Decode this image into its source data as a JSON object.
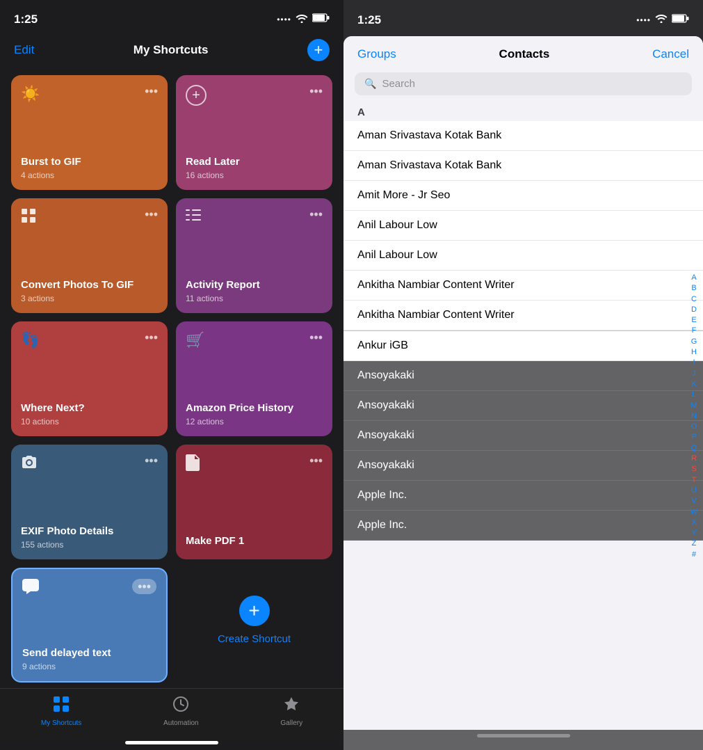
{
  "leftPanel": {
    "statusBar": {
      "time": "1:25"
    },
    "navBar": {
      "editLabel": "Edit",
      "title": "My Shortcuts",
      "addButtonLabel": "+"
    },
    "shortcuts": [
      {
        "id": "burst-to-gif",
        "title": "Burst to GIF",
        "actions": "4 actions",
        "icon": "☀",
        "colorClass": "card-burst"
      },
      {
        "id": "read-later",
        "title": "Read Later",
        "actions": "16 actions",
        "icon": "+",
        "colorClass": "card-read-later",
        "isAddIcon": true
      },
      {
        "id": "convert-photos",
        "title": "Convert Photos To GIF",
        "actions": "3 actions",
        "icon": "⊞",
        "colorClass": "card-convert"
      },
      {
        "id": "activity-report",
        "title": "Activity Report",
        "actions": "11 actions",
        "icon": "≡",
        "colorClass": "card-activity"
      },
      {
        "id": "where-next",
        "title": "Where Next?",
        "actions": "10 actions",
        "icon": "👣",
        "colorClass": "card-where-next"
      },
      {
        "id": "amazon-price",
        "title": "Amazon Price History",
        "actions": "12 actions",
        "icon": "🛒",
        "colorClass": "card-amazon"
      },
      {
        "id": "exif-photo",
        "title": "EXIF Photo Details",
        "actions": "155 actions",
        "icon": "⊙",
        "colorClass": "card-exif"
      },
      {
        "id": "make-pdf",
        "title": "Make PDF 1",
        "actions": "",
        "icon": "📄",
        "colorClass": "card-make-pdf"
      }
    ],
    "sendDelayed": {
      "title": "Send delayed text",
      "actions": "9 actions",
      "icon": "💬",
      "colorClass": "card-send-delayed"
    },
    "createShortcutLabel": "Create Shortcut",
    "tabBar": {
      "tabs": [
        {
          "id": "my-shortcuts",
          "label": "My Shortcuts",
          "icon": "⊞",
          "active": true
        },
        {
          "id": "automation",
          "label": "Automation",
          "icon": "🕐",
          "active": false
        },
        {
          "id": "gallery",
          "label": "Gallery",
          "icon": "🎓",
          "active": false
        }
      ]
    }
  },
  "rightPanel": {
    "statusBar": {
      "time": "1:25"
    },
    "contacts": {
      "groupsLabel": "Groups",
      "title": "Contacts",
      "cancelLabel": "Cancel",
      "searchPlaceholder": "Search",
      "sectionHeader": "A",
      "contacts": [
        {
          "name": "Aman Srivastava Kotak Bank",
          "highlighted": false
        },
        {
          "name": "Aman Srivastava Kotak Bank",
          "highlighted": false
        },
        {
          "name": "Amit More - Jr Seo",
          "highlighted": false
        },
        {
          "name": "Anil Labour Low",
          "highlighted": false
        },
        {
          "name": "Anil Labour Low",
          "highlighted": false
        },
        {
          "name": "Ankitha Nambiar Content Writer",
          "highlighted": false
        },
        {
          "name": "Ankitha Nambiar Content Writer",
          "highlighted": false
        },
        {
          "name": "Ankur iGB",
          "highlighted": true
        },
        {
          "name": "Ansoyakaki",
          "highlighted": false
        },
        {
          "name": "Ansoyakaki",
          "highlighted": false
        },
        {
          "name": "Ansoyakaki",
          "highlighted": false
        },
        {
          "name": "Ansoyakaki",
          "highlighted": false
        },
        {
          "name": "Apple Inc.",
          "highlighted": false
        },
        {
          "name": "Apple Inc.",
          "highlighted": false
        }
      ],
      "alphaIndex": [
        "A",
        "B",
        "C",
        "D",
        "E",
        "F",
        "G",
        "H",
        "I",
        "J",
        "K",
        "L",
        "M",
        "N",
        "O",
        "P",
        "Q",
        "R",
        "S",
        "T",
        "U",
        "V",
        "W",
        "X",
        "Y",
        "Z",
        "#"
      ]
    }
  }
}
